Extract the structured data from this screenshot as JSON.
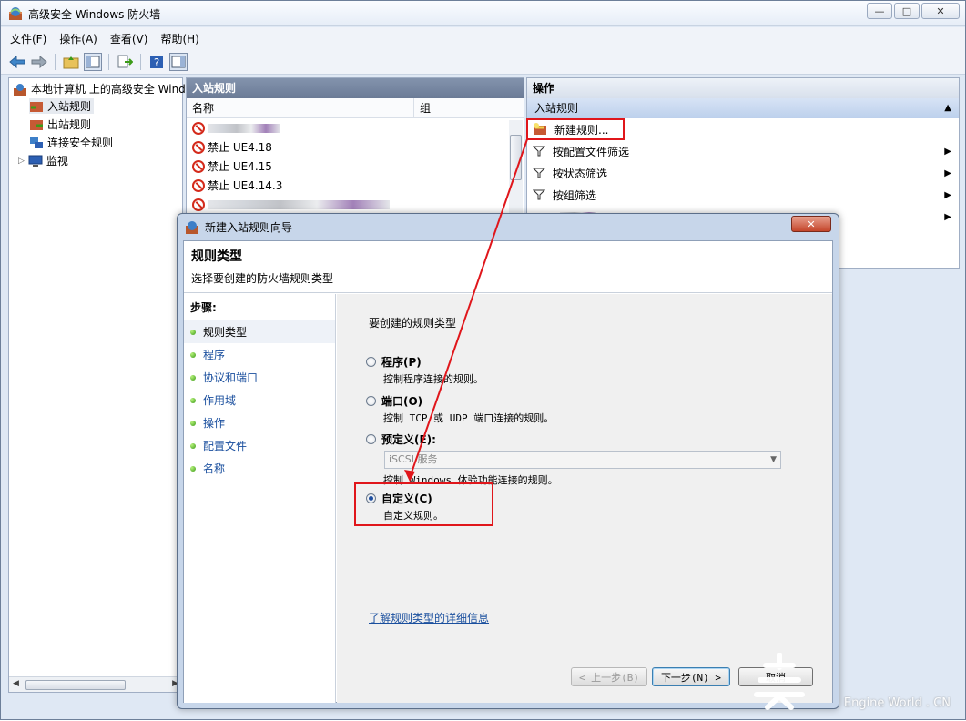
{
  "window": {
    "title": "高级安全 Windows 防火墙",
    "minimize_glyph": "▭",
    "maximize_glyph": "□",
    "close_glyph": "✕"
  },
  "menu": [
    "文件(F)",
    "操作(A)",
    "查看(V)",
    "帮助(H)"
  ],
  "tree": {
    "root": "本地计算机 上的高级安全 Wind",
    "items": [
      "入站规则",
      "出站规则",
      "连接安全规则",
      "监视"
    ]
  },
  "middle": {
    "header": "入站规则",
    "col_name": "名称",
    "col_group": "组",
    "rules": [
      "禁止 UE4.18",
      "禁止 UE4.15",
      "禁止 UE4.14.3"
    ]
  },
  "actions": {
    "header": "操作",
    "section": "入站规则",
    "items": [
      "新建规则...",
      "按配置文件筛选",
      "按状态筛选",
      "按组筛选"
    ]
  },
  "dialog": {
    "title": "新建入站规则向导",
    "close": "✕",
    "heading": "规则类型",
    "subheading": "选择要创建的防火墙规则类型",
    "steps_label": "步骤:",
    "steps": [
      "规则类型",
      "程序",
      "协议和端口",
      "作用域",
      "操作",
      "配置文件",
      "名称"
    ],
    "prompt": "要创建的规则类型",
    "options": [
      {
        "title": "程序(P)",
        "desc": "控制程序连接的规则。",
        "checked": false
      },
      {
        "title": "端口(O)",
        "desc": "控制 TCP 或 UDP 端口连接的规则。",
        "checked": false
      },
      {
        "title": "预定义(E):",
        "desc": "控制 Windows 体验功能连接的规则。",
        "checked": false
      },
      {
        "title": "自定义(C)",
        "desc": "自定义规则。",
        "checked": true
      }
    ],
    "predefined_value": "iSCSI 服务",
    "link": "了解规则类型的详细信息",
    "back_button": "< 上一步(B)",
    "next_button": "下一步(N) >",
    "cancel_button": "取消"
  },
  "watermark": "Engine World . CN",
  "colors": {
    "highlight": "#e0161b",
    "link": "#1a4f9e"
  }
}
